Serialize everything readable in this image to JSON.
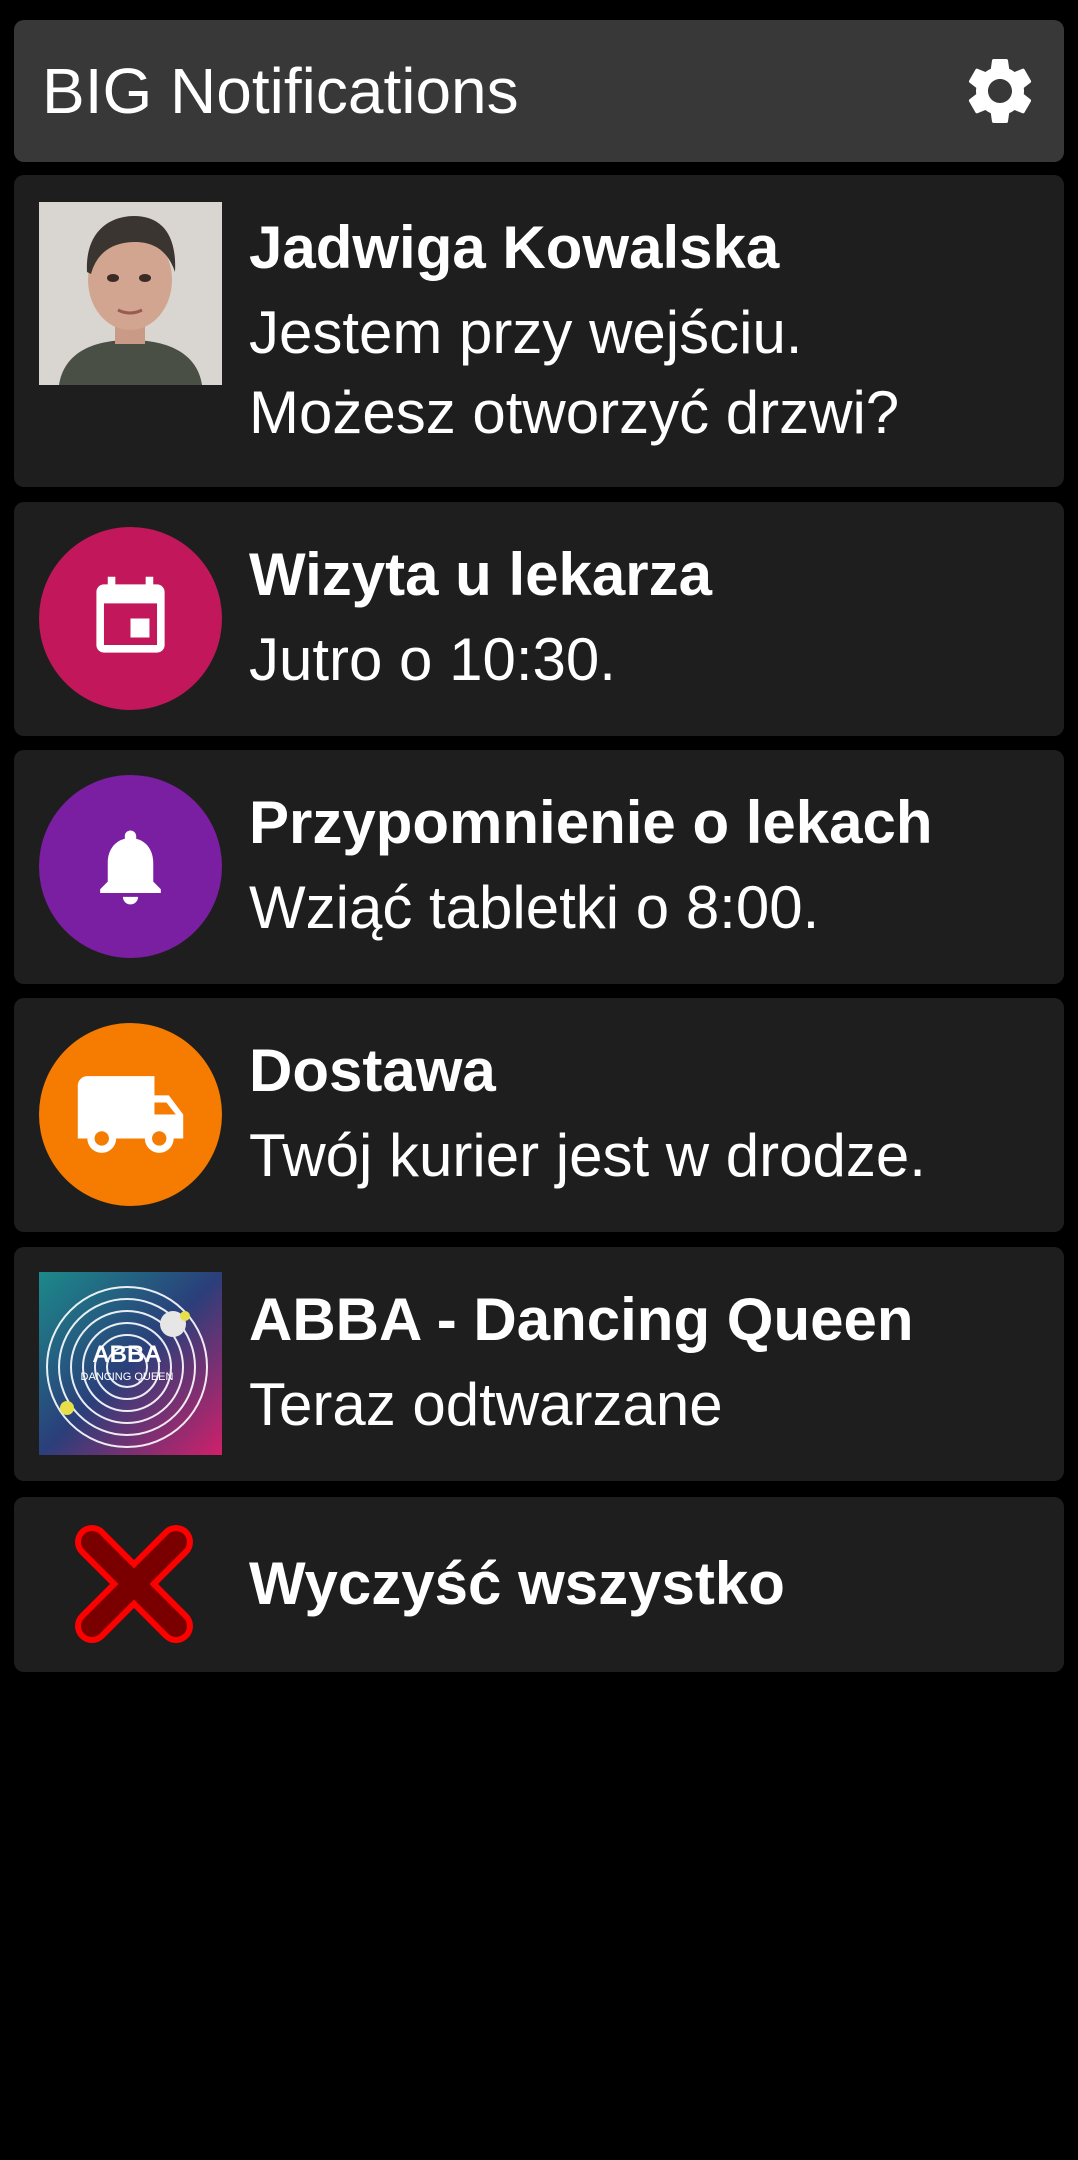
{
  "app": {
    "title": "BIG Notifications"
  },
  "notifications": [
    {
      "title": "Jadwiga Kowalska",
      "body_line1": "Jestem przy wejściu.",
      "body_line2": "Możesz otworzyć drzwi?",
      "icon": "contact-photo"
    },
    {
      "title": "Wizyta u lekarza",
      "body": "Jutro o 10:30.",
      "icon": "calendar-icon",
      "color": "#c2185b"
    },
    {
      "title": "Przypomnienie o lekach",
      "body": "Wziąć tabletki o 8:00.",
      "icon": "bell-icon",
      "color": "#7b1fa2"
    },
    {
      "title": "Dostawa",
      "body": "Twój kurier jest w drodze.",
      "icon": "truck-icon",
      "color": "#f57c00"
    },
    {
      "title": "ABBA - Dancing Queen",
      "body": "Teraz odtwarzane",
      "icon": "album-art",
      "album_art_text": "ABBA",
      "album_art_subtext": "DANCING QUEEN"
    }
  ],
  "clear_all": {
    "label": "Wyczyść wszystko",
    "icon": "close-x-icon",
    "color": "#e00000"
  },
  "colors": {
    "background": "#000000",
    "header": "#383838",
    "card": "#1e1e1e",
    "text": "#ffffff"
  }
}
